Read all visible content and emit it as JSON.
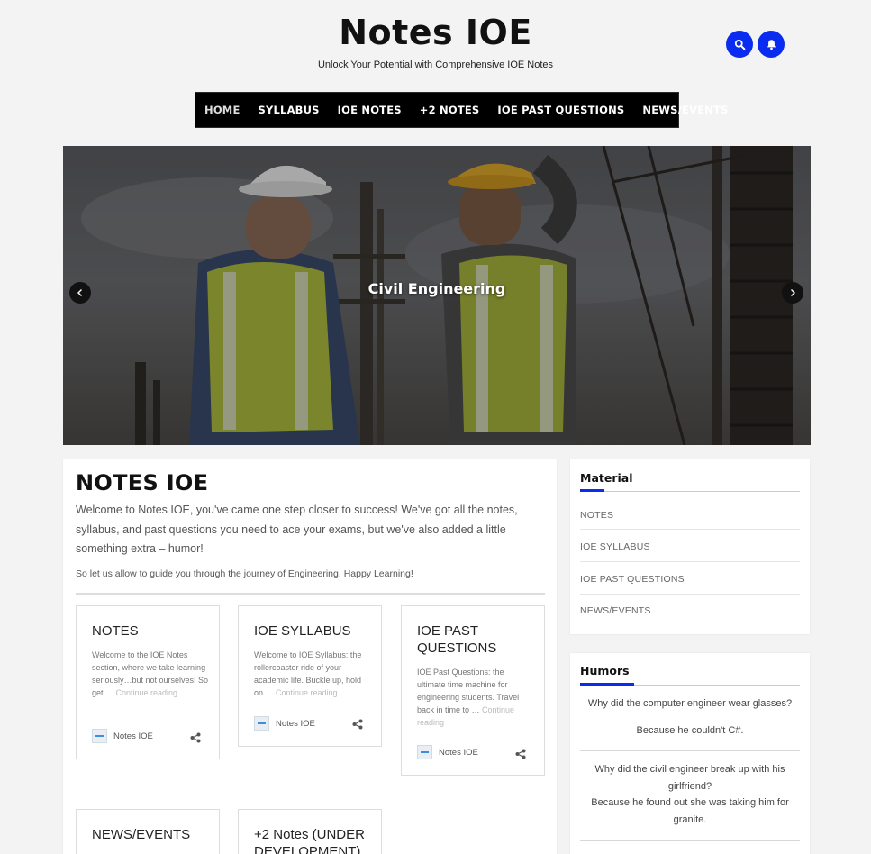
{
  "header": {
    "site_title": "Notes IOE",
    "tagline": "Unlock Your Potential with Comprehensive IOE Notes",
    "search_icon": "search-icon",
    "bell_icon": "bell-icon",
    "accent_color": "#0a2cf0"
  },
  "nav": {
    "items": [
      {
        "label": "HOME"
      },
      {
        "label": "SYLLABUS"
      },
      {
        "label": "IOE NOTES"
      },
      {
        "label": "+2 NOTES"
      },
      {
        "label": "IOE PAST QUESTIONS"
      },
      {
        "label": "NEWS/EVENTS"
      }
    ]
  },
  "hero": {
    "caption": "Civil Engineering",
    "prev_icon": "chevron-left-icon",
    "next_icon": "chevron-right-icon"
  },
  "main": {
    "title": "NOTES IOE",
    "intro": "Welcome to Notes IOE, you've came one step closer to success! We've got all the notes, syllabus, and past questions you need to ace your exams, but we've also added a little something extra – humor!",
    "sub": "So let us allow to guide you through the journey of Engineering. Happy Learning!",
    "cards": [
      {
        "title": "NOTES",
        "desc": "Welcome to the IOE Notes section, where we take learning seriously…but not ourselves! So get … ",
        "more": "Continue reading",
        "author": "Notes IOE"
      },
      {
        "title": "IOE SYLLABUS",
        "desc": "Welcome to IOE Syllabus: the rollercoaster ride of your academic life. Buckle up, hold on … ",
        "more": "Continue reading",
        "author": "Notes IOE"
      },
      {
        "title": "IOE PAST QUESTIONS",
        "desc": "IOE Past Questions: the ultimate time machine for engineering students. Travel back in time to … ",
        "more": "Continue reading",
        "author": "Notes IOE"
      },
      {
        "title": "NEWS/EVENTS"
      },
      {
        "title": "+2 Notes (UNDER DEVELOPMENT)"
      }
    ]
  },
  "sidebar": {
    "material": {
      "title": "Material",
      "items": [
        "NOTES",
        "IOE SYLLABUS",
        "IOE PAST QUESTIONS",
        "NEWS/EVENTS"
      ]
    },
    "humors": {
      "title": "Humors",
      "jokes": [
        {
          "question": "Why did the computer engineer wear glasses?",
          "answer": "Because he couldn't C#."
        },
        {
          "question": "Why did the civil engineer break up with his girlfriend?",
          "answer": "Because he found out she was taking him for granite."
        }
      ]
    }
  }
}
